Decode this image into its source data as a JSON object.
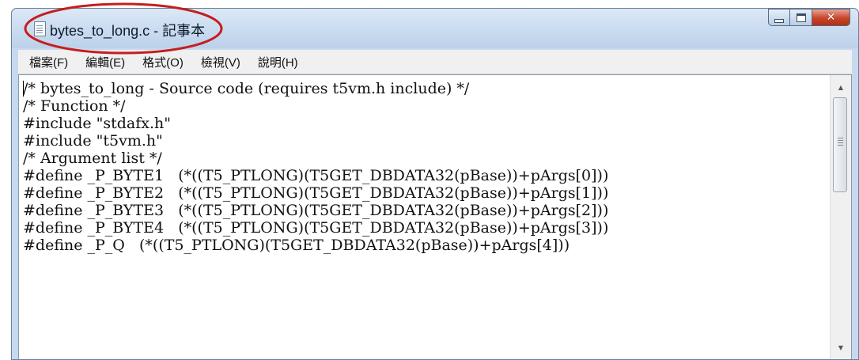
{
  "window": {
    "title": "bytes_to_long.c - 記事本"
  },
  "menubar": {
    "items": [
      "檔案(F)",
      "編輯(E)",
      "格式(O)",
      "檢視(V)",
      "說明(H)"
    ]
  },
  "editor": {
    "lines": [
      "/* bytes_to_long - Source code (requires t5vm.h include) */",
      "/* Function */",
      "#include \"stdafx.h\"",
      "#include \"t5vm.h\"",
      "/* Argument list */",
      "",
      "#define _P_BYTE1   (*((T5_PTLONG)(T5GET_DBDATA32(pBase))+pArgs[0]))",
      "#define _P_BYTE2   (*((T5_PTLONG)(T5GET_DBDATA32(pBase))+pArgs[1]))",
      "#define _P_BYTE3   (*((T5_PTLONG)(T5GET_DBDATA32(pBase))+pArgs[2]))",
      "#define _P_BYTE4   (*((T5_PTLONG)(T5GET_DBDATA32(pBase))+pArgs[3]))",
      "#define _P_Q   (*((T5_PTLONG)(T5GET_DBDATA32(pBase))+pArgs[4]))"
    ]
  },
  "icons": {
    "app": "notepad-icon",
    "minimize": "minimize-icon",
    "maximize": "maximize-icon",
    "close": "close-icon",
    "scroll_up": "chevron-up-icon",
    "scroll_down": "chevron-down-icon",
    "scroll_grip": "grip-icon"
  },
  "colors": {
    "annotation": "#c41e1e",
    "close_button": "#c8452a",
    "titlebar": "#c6d9ee"
  }
}
